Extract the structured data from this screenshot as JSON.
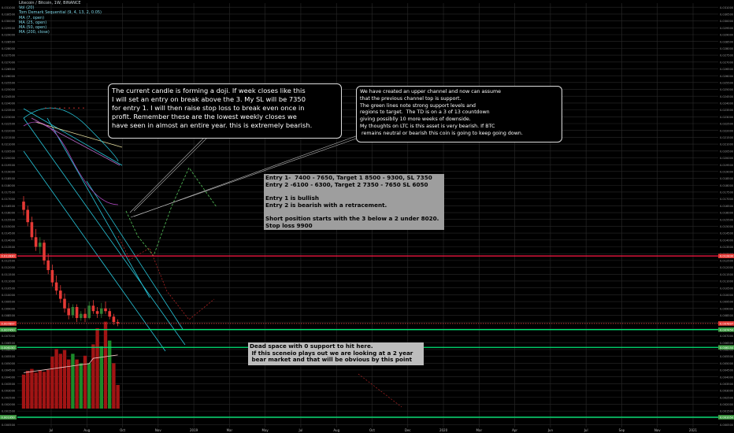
{
  "legend": [
    "Litecoin / Bitcoin, 1W, BINANCE",
    "Vol (20)",
    "Tom Demark Sequential (9, 4, 13, 2, 0.05)",
    "MA (7, open)",
    "MA (25, open)",
    "MA (50, open)",
    "MA (200, close)"
  ],
  "notes": {
    "doji": "The current candle is forming a doji. If week closes like this\nI will set an entry on break above the 3. My SL will be 7350\nfor entry 1. I will then raise stop loss to break even once in\nprofit. Remember these are the lowest weekly closes we\nhave seen in almost an entire year. this is extremely bearish.",
    "channel": "We have created an upper channel and now can assume\nthat the previous channel top is support.\nThe green lines note strong support levels and\nregions to target.  The TD is on a 3 of 13 countdown\ngiving possiblly 10 more weeks of downside.\nMy thoughts on LTC is this asset is very bearish. If BTC\n remains neutral or bearish this coin is going to keep going down.",
    "entries": "Entry 1-  7400 - 7650, Target 1 8500 - 9300, SL 7350\nEntry 2 -6100 - 6300, Target 2 7350 - 7650 SL 6050\n\nEntry 1 is bullish\nEntry 2 is bearish with a retracement.\n\nShort position starts with the 3 below a 2 under 8020.\nStop loss 9900",
    "dead": "Dead space with 0 support to hit here.\n If this sceneio plays out we are looking at a 2 year\n bear market and that will be obvious by this point"
  },
  "chart_data": {
    "type": "candlestick",
    "symbol": "Litecoin / Bitcoin",
    "interval": "1W",
    "exchange": "BINANCE",
    "y_ticks": [
      0.031,
      0.0305,
      0.03,
      0.0295,
      0.029,
      0.0285,
      0.028,
      0.0275,
      0.027,
      0.0265,
      0.026,
      0.0255,
      0.025,
      0.0245,
      0.024,
      0.0235,
      0.023,
      0.0225,
      0.022,
      0.0215,
      0.021,
      0.0205,
      0.02,
      0.0195,
      0.019,
      0.0185,
      0.018,
      0.0175,
      0.017,
      0.0165,
      0.016,
      0.0155,
      0.015,
      0.0145,
      0.014,
      0.0135,
      0.013,
      0.0125,
      0.012,
      0.0115,
      0.011,
      0.0105,
      0.01,
      0.0095,
      0.009,
      0.0085,
      0.008,
      0.0075,
      0.007,
      0.0065,
      0.006,
      0.0055,
      0.005,
      0.0045,
      0.004,
      0.0035,
      0.003,
      0.0025,
      0.002,
      0.0015,
      0.001,
      0.0005
    ],
    "x_ticks": [
      "Jul",
      "Aug",
      "Oct",
      "Nov",
      "2019",
      "Mar",
      "May",
      "Jul",
      "Aug",
      "Oct",
      "Dec",
      "2020",
      "Mar",
      "Apr",
      "Jun",
      "Jul",
      "Sep",
      "Nov",
      "2021"
    ],
    "price_labels": [
      {
        "value": 0.01283,
        "text": "0.012830",
        "color": "#e53935"
      },
      {
        "value": 0.007897,
        "text": "0.007897",
        "color": "#e53935"
      },
      {
        "value": 0.00745,
        "text": "0.007450",
        "color": "#43a047"
      },
      {
        "value": 0.00615,
        "text": "0.006150",
        "color": "#43a047"
      },
      {
        "value": 0.00105,
        "text": "0.001050",
        "color": "#43a047"
      }
    ],
    "horizontal_levels": [
      {
        "value": 0.01283,
        "color": "#ff1744",
        "style": "solid"
      },
      {
        "value": 0.0079,
        "color": "#ff5252",
        "style": "dotted"
      },
      {
        "value": 0.00745,
        "color": "#00e676",
        "style": "solid"
      },
      {
        "value": 0.00615,
        "color": "#00e676",
        "style": "solid"
      },
      {
        "value": 0.00105,
        "color": "#00e676",
        "style": "solid"
      }
    ],
    "candles": [
      {
        "o": 0.0168,
        "h": 0.0172,
        "l": 0.0158,
        "c": 0.0162
      },
      {
        "o": 0.0162,
        "h": 0.0165,
        "l": 0.015,
        "c": 0.0153
      },
      {
        "o": 0.0153,
        "h": 0.0157,
        "l": 0.014,
        "c": 0.0142
      },
      {
        "o": 0.0142,
        "h": 0.0148,
        "l": 0.0132,
        "c": 0.0135
      },
      {
        "o": 0.0135,
        "h": 0.0142,
        "l": 0.013,
        "c": 0.0138
      },
      {
        "o": 0.0138,
        "h": 0.014,
        "l": 0.0122,
        "c": 0.0125
      },
      {
        "o": 0.0125,
        "h": 0.013,
        "l": 0.0115,
        "c": 0.0118
      },
      {
        "o": 0.0118,
        "h": 0.0122,
        "l": 0.0106,
        "c": 0.0109
      },
      {
        "o": 0.0109,
        "h": 0.0114,
        "l": 0.01,
        "c": 0.0103
      },
      {
        "o": 0.0103,
        "h": 0.0107,
        "l": 0.0094,
        "c": 0.0097
      },
      {
        "o": 0.0097,
        "h": 0.0101,
        "l": 0.0087,
        "c": 0.009
      },
      {
        "o": 0.009,
        "h": 0.0094,
        "l": 0.0082,
        "c": 0.0085
      },
      {
        "o": 0.0085,
        "h": 0.0093,
        "l": 0.0083,
        "c": 0.0091
      },
      {
        "o": 0.0091,
        "h": 0.0093,
        "l": 0.008,
        "c": 0.0083
      },
      {
        "o": 0.0083,
        "h": 0.0088,
        "l": 0.0081,
        "c": 0.0086
      },
      {
        "o": 0.0086,
        "h": 0.009,
        "l": 0.008,
        "c": 0.0083
      },
      {
        "o": 0.0083,
        "h": 0.0095,
        "l": 0.0082,
        "c": 0.0092
      },
      {
        "o": 0.0092,
        "h": 0.0096,
        "l": 0.0086,
        "c": 0.0088
      },
      {
        "o": 0.0088,
        "h": 0.0091,
        "l": 0.0083,
        "c": 0.0086
      },
      {
        "o": 0.0086,
        "h": 0.0094,
        "l": 0.0083,
        "c": 0.009
      },
      {
        "o": 0.009,
        "h": 0.0095,
        "l": 0.0086,
        "c": 0.0088
      },
      {
        "o": 0.0088,
        "h": 0.009,
        "l": 0.0082,
        "c": 0.0084
      },
      {
        "o": 0.0084,
        "h": 0.0086,
        "l": 0.0078,
        "c": 0.008
      },
      {
        "o": 0.008,
        "h": 0.0082,
        "l": 0.0077,
        "c": 0.0079
      }
    ],
    "volume_relative": [
      0.36,
      0.4,
      0.42,
      0.38,
      0.4,
      0.39,
      0.41,
      0.55,
      0.63,
      0.58,
      0.62,
      0.52,
      0.58,
      0.52,
      0.48,
      0.56,
      0.48,
      0.68,
      0.85,
      0.66,
      0.92,
      0.72,
      0.48,
      0.25
    ],
    "volume_up": [
      false,
      false,
      false,
      false,
      false,
      false,
      false,
      false,
      false,
      false,
      false,
      false,
      true,
      false,
      true,
      false,
      true,
      false,
      false,
      true,
      false,
      true,
      false,
      false
    ],
    "grid": true
  }
}
